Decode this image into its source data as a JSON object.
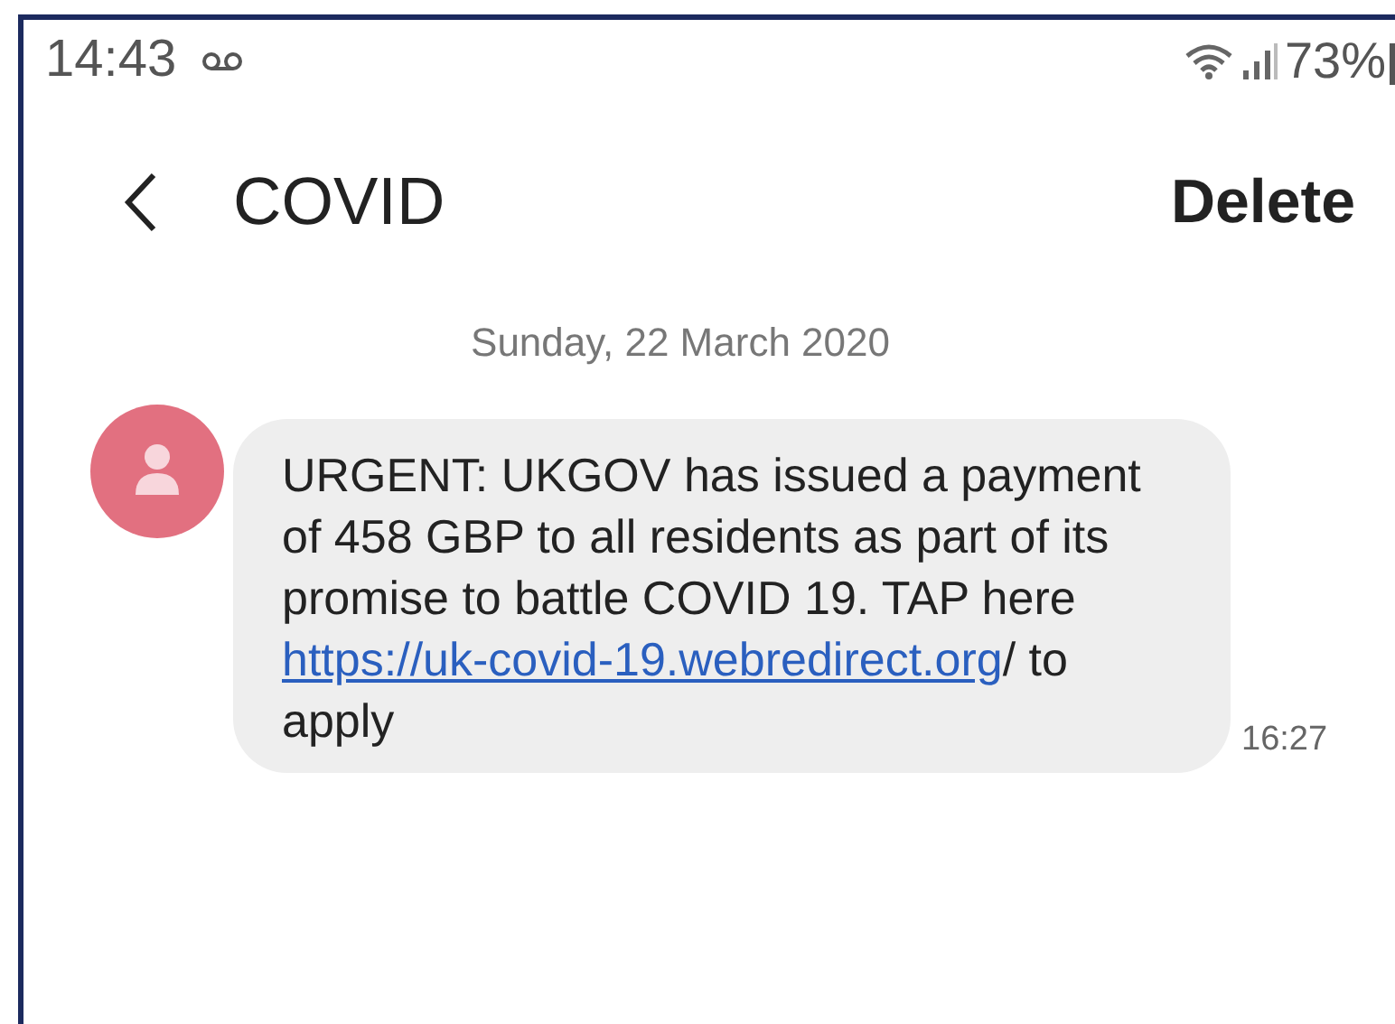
{
  "status_bar": {
    "time": "14:43",
    "battery": "73%"
  },
  "header": {
    "title": "COVID",
    "action": "Delete"
  },
  "date_separator": "Sunday, 22 March 2020",
  "messages": [
    {
      "text_before": "URGENT: UKGOV has issued a payment of 458 GBP to all residents as part of its promise to battle COVID 19. TAP here",
      "link": "https://uk-covid-19.webredirect.org",
      "text_after": "/ to apply",
      "time": "16:27"
    }
  ]
}
